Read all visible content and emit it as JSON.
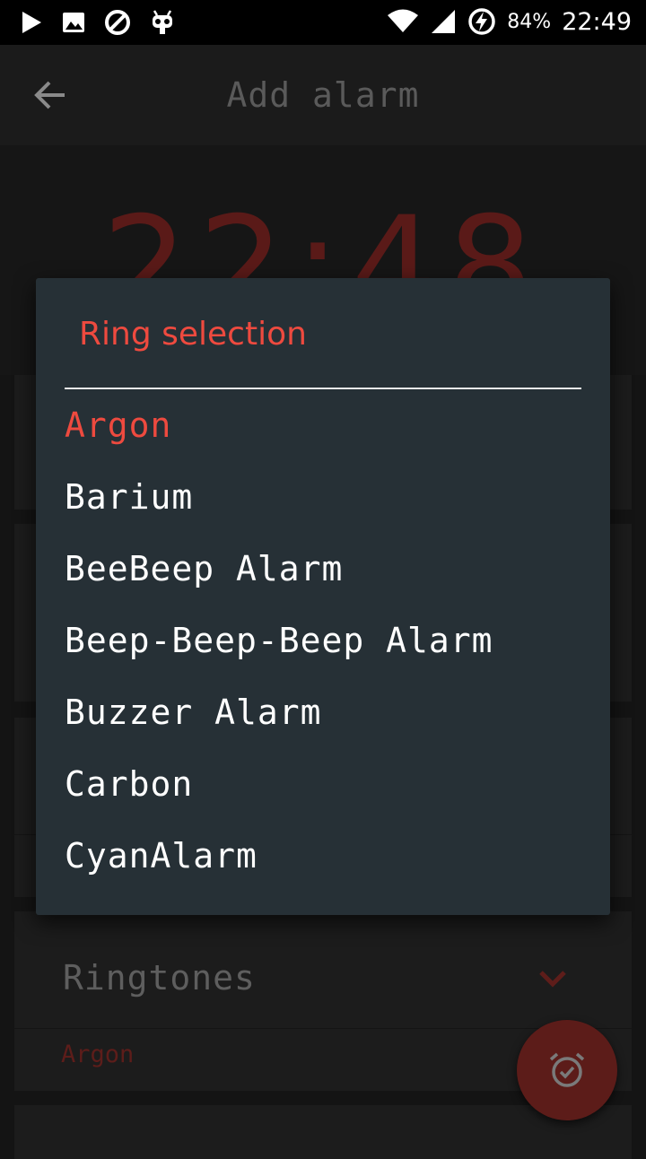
{
  "status_bar": {
    "icons": [
      "play-icon",
      "image-icon",
      "blocked-icon",
      "robot-icon",
      "wifi-icon",
      "signal-icon",
      "battery-charging-icon"
    ],
    "battery_percent": "84%",
    "time": "22:49"
  },
  "app_bar": {
    "title": "Add alarm",
    "back_icon": "arrow-left-icon"
  },
  "alarm": {
    "time": "22:48"
  },
  "ringtones_card": {
    "label": "Ringtones",
    "value": "Argon",
    "chevron_icon": "chevron-down-icon"
  },
  "fab": {
    "icon": "alarm-check-icon"
  },
  "dialog": {
    "title": "Ring selection",
    "selected": "Argon",
    "options": [
      "Argon",
      "Barium",
      "BeeBeep Alarm",
      "Beep-Beep-Beep Alarm",
      "Buzzer Alarm",
      "Carbon",
      "CyanAlarm"
    ]
  },
  "colors": {
    "accent": "#ee4a3f",
    "dialog_bg": "#263036",
    "dimmed_accent": "#5c1c19",
    "background": "#141414"
  }
}
